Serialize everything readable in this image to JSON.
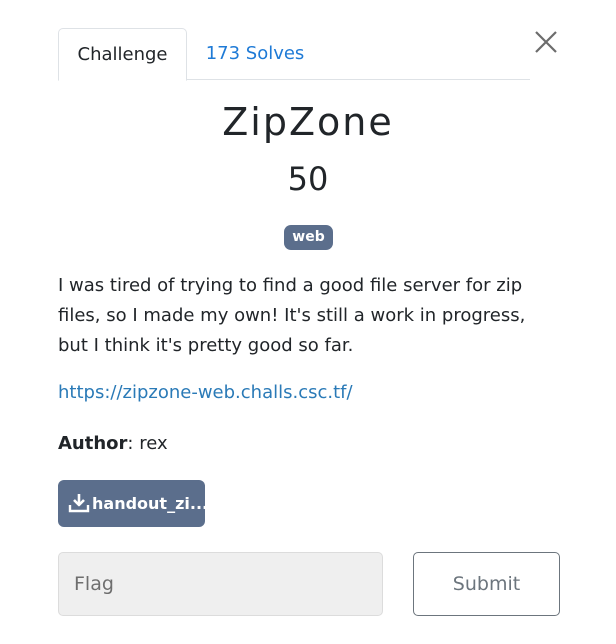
{
  "tabs": {
    "challenge_label": "Challenge",
    "solves_label": "173 Solves"
  },
  "challenge": {
    "name": "ZipZone",
    "value": "50",
    "tag": "web",
    "description": "I was tired of trying to find a good file server for zip files, so I made my own! It's still a work in progress, but I think it's pretty good so far.",
    "link": "https://zipzone-web.challs.csc.tf/",
    "author_label": "Author",
    "author_sep": ": ",
    "author_name": "rex",
    "file_label": "handout_zi..."
  },
  "form": {
    "flag_placeholder": "Flag",
    "submit_label": "Submit"
  },
  "colors": {
    "accent_link": "#2a7ab7",
    "tab_link": "#1e7ad6",
    "badge_bg": "#5b6e8c"
  },
  "icons": {
    "close": "close-icon",
    "download": "download-icon"
  }
}
